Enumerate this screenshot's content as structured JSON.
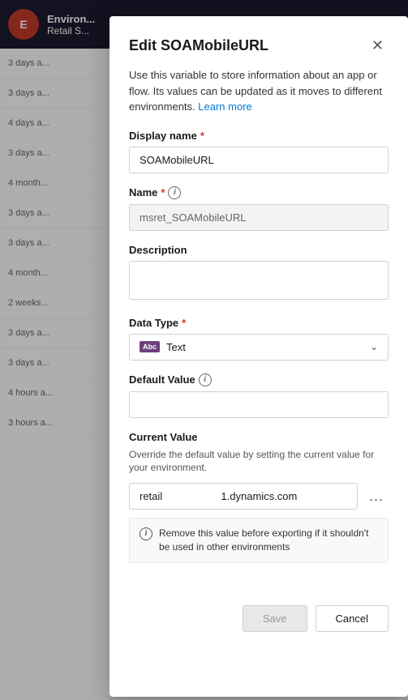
{
  "app": {
    "org_name": "Environ...",
    "org_sub": "Retail S...",
    "avatar_label": "E"
  },
  "bg_list": {
    "items": [
      {
        "time": "3 days a..."
      },
      {
        "time": "3 days a..."
      },
      {
        "time": "4 days a..."
      },
      {
        "time": "3 days a..."
      },
      {
        "time": "4 month..."
      },
      {
        "time": "3 days a..."
      },
      {
        "time": "3 days a..."
      },
      {
        "time": "4 month..."
      },
      {
        "time": "2 weeks..."
      },
      {
        "time": "3 days a..."
      },
      {
        "time": "3 days a..."
      },
      {
        "time": "4 hours a..."
      },
      {
        "time": "3 hours a..."
      }
    ]
  },
  "modal": {
    "title": "Edit SOAMobileURL",
    "close_label": "✕",
    "description": "Use this variable to store information about an app or flow. Its values can be updated as it moves to different environments.",
    "learn_more_label": "Learn more",
    "display_name_label": "Display name",
    "display_name_required": "*",
    "display_name_value": "SOAMobileURL",
    "name_label": "Name",
    "name_required": "*",
    "name_value": "msret_SOAMobileURL",
    "description_label": "Description",
    "description_placeholder": "",
    "data_type_label": "Data Type",
    "data_type_required": "*",
    "data_type_icon": "Abc",
    "data_type_value": "Text",
    "default_value_label": "Default Value",
    "default_value_placeholder": "",
    "current_value_label": "Current Value",
    "current_value_desc": "Override the default value by setting the current value for your environment.",
    "current_value_part1": "retail",
    "current_value_part2": "1.dynamics.com",
    "info_banner_text": "Remove this value before exporting if it shouldn't be used in other environments",
    "ellipsis_label": "...",
    "save_label": "Save",
    "cancel_label": "Cancel"
  },
  "colors": {
    "accent": "#0078d4",
    "required": "#d13438",
    "data_type_icon_bg": "#6c3f7a"
  }
}
